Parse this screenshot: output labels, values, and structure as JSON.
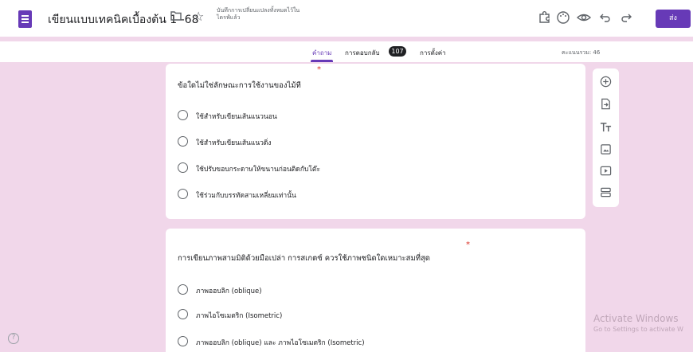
{
  "header": {
    "doc_title": "เขียนแบบเทคนิคเบื้องต้น 1 -68",
    "save_status": "บันทึกการเปลี่ยนแปลงทั้งหมดไว้ในไดรฟ์แล้ว",
    "send_label": "ส่ง"
  },
  "tabs": {
    "questions": "คำถาม",
    "responses": "การตอบกลับ",
    "responses_count": "107",
    "settings": "การตั้งค่า",
    "total_score": "คะแนนรวม: 46"
  },
  "questions": [
    {
      "title": "ข้อใดไม่ใช่ลักษณะการใช้งานของไม้ที",
      "options": [
        "ใช้สำหรับเขียนเส้นแนวนอน",
        "ใช้สำหรับเขียนเส้นแนวดิ่ง",
        "ใช้ปรับขอบกระดาษให้ขนานก่อนติดกับโต๊ะ",
        "ใช้ร่วมกับบรรทัดสามเหลี่ยมเท่านั้น"
      ]
    },
    {
      "title": "การเขียนภาพสามมิติด้วยมือเปล่า การสเกตซ์ ควรใช้ภาพชนิดใดเหมาะสมที่สุด",
      "options": [
        "ภาพออบลิก (oblique)",
        "ภาพไอโซเมตริก (Isometric)",
        "ภาพออบลิก (oblique) และ ภาพไอโซเมตริก (Isometric)"
      ]
    }
  ],
  "watermark": {
    "line1": "Activate Windows",
    "line2": "Go to Settings to activate W"
  },
  "colors": {
    "accent": "#673ab7",
    "background": "#f1d7ea",
    "required": "#d93025"
  }
}
